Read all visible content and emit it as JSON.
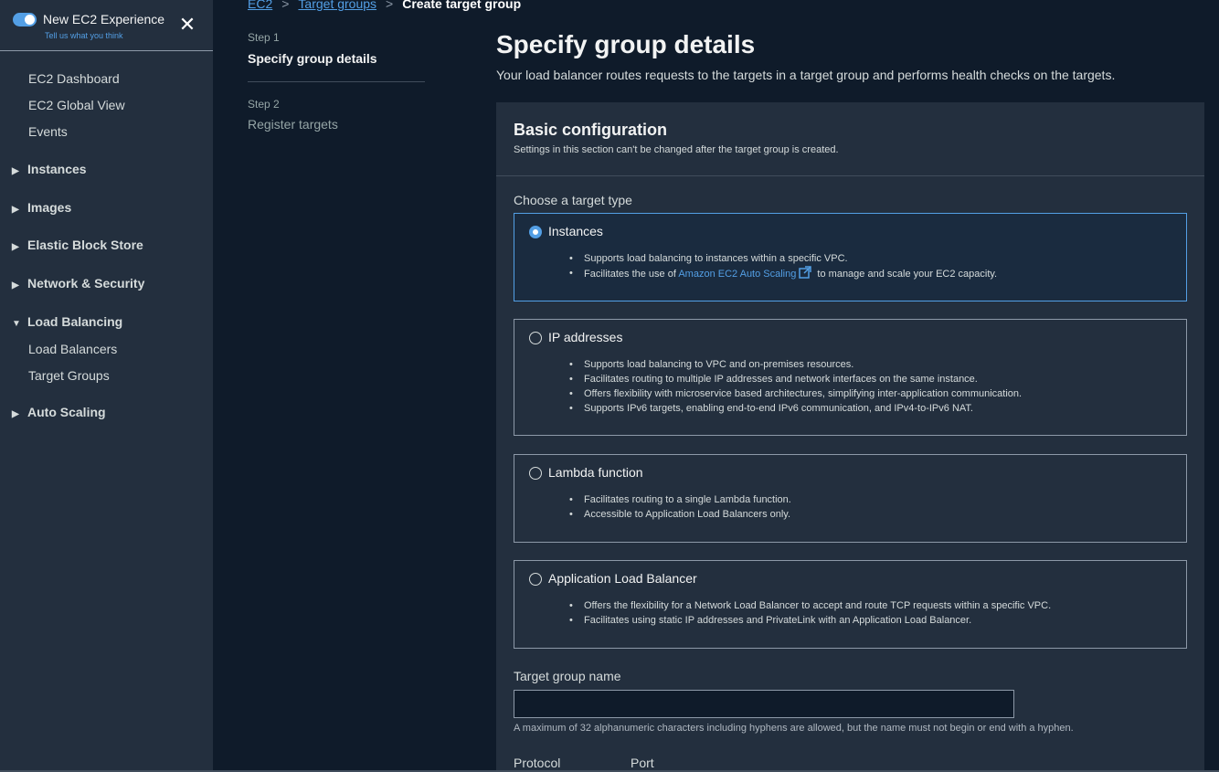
{
  "sidebar": {
    "toggle_title": "New EC2 Experience",
    "toggle_sub": "Tell us what you think",
    "close_glyph": "✕",
    "items": [
      {
        "label": "EC2 Dashboard"
      },
      {
        "label": "EC2 Global View"
      },
      {
        "label": "Events"
      }
    ],
    "sections": [
      {
        "label": "Instances",
        "caret": "▶"
      },
      {
        "label": "Images",
        "caret": "▶"
      },
      {
        "label": "Elastic Block Store",
        "caret": "▶"
      },
      {
        "label": "Network & Security",
        "caret": "▶"
      },
      {
        "label": "Load Balancing",
        "caret": "▼"
      },
      {
        "label": "Auto Scaling",
        "caret": "▶"
      }
    ],
    "lb_items": [
      {
        "label": "Load Balancers"
      },
      {
        "label": "Target Groups"
      }
    ]
  },
  "breadcrumb": {
    "items": [
      "EC2",
      "Target groups"
    ],
    "separator": ">",
    "current": "Create target group"
  },
  "steps": [
    {
      "label": "Step 1",
      "title": "Specify group details"
    },
    {
      "label": "Step 2",
      "title": "Register targets"
    }
  ],
  "page": {
    "title": "Specify group details",
    "description": "Your load balancer routes requests to the targets in a target group and performs health checks on the targets."
  },
  "basic_config": {
    "title": "Basic configuration",
    "subtitle": "Settings in this section can't be changed after the target group is created.",
    "target_type_label": "Choose a target type",
    "options": [
      {
        "title": "Instances",
        "selected": true,
        "bullets": [
          "Supports load balancing to instances within a specific VPC."
        ],
        "bullet2_prefix": "Facilitates the use of ",
        "bullet2_link": "Amazon EC2 Auto Scaling",
        "bullet2_suffix": " to manage and scale your EC2 capacity."
      },
      {
        "title": "IP addresses",
        "selected": false,
        "bullets": [
          "Supports load balancing to VPC and on-premises resources.",
          "Facilitates routing to multiple IP addresses and network interfaces on the same instance.",
          "Offers flexibility with microservice based architectures, simplifying inter-application communication.",
          "Supports IPv6 targets, enabling end-to-end IPv6 communication, and IPv4-to-IPv6 NAT."
        ]
      },
      {
        "title": "Lambda function",
        "selected": false,
        "bullets": [
          "Facilitates routing to a single Lambda function.",
          "Accessible to Application Load Balancers only."
        ]
      },
      {
        "title": "Application Load Balancer",
        "selected": false,
        "bullets": [
          "Offers the flexibility for a Network Load Balancer to accept and route TCP requests within a specific VPC.",
          "Facilitates using static IP addresses and PrivateLink with an Application Load Balancer."
        ]
      }
    ],
    "name_label": "Target group name",
    "name_value": "",
    "name_hint": "A maximum of 32 alphanumeric characters including hyphens are allowed, but the name must not begin or end with a hyphen.",
    "protocol_label": "Protocol",
    "port_label": "Port"
  },
  "colors": {
    "accent": "#539fe5",
    "background": "#0f1b2a",
    "panel": "#232f3e",
    "selected_tile": "#1a2b3f"
  },
  "icons": {
    "close": "close-icon",
    "external_link": "external-link-icon",
    "caret_right": "caret-right-icon",
    "caret_down": "caret-down-icon"
  }
}
